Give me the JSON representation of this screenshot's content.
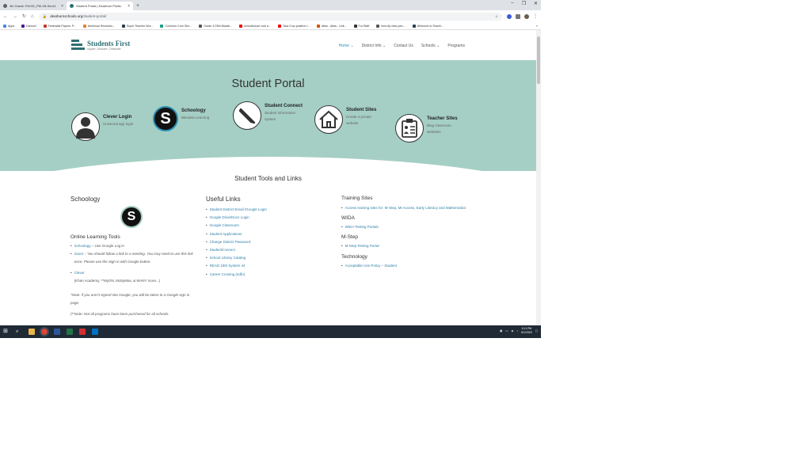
{
  "browser": {
    "tabs": [
      {
        "title": "4th Grade: PerXD_PM-1B-Sec11",
        "active": false
      },
      {
        "title": "Student Portal | Dearborn Public",
        "active": true
      }
    ],
    "new_tab": "+",
    "url_host": "dearbornschools.org",
    "url_path": "/student-portal/",
    "bookmarks": [
      "Apps",
      "Kahoot!",
      "Federalist Papers: P...",
      "American Revolutio...",
      "Super Teacher Wor...",
      "Common Core She...",
      "Grade 4 DRA Blackli...",
      "schoolhouse rock b...",
      "Tara Cruz-positive t...",
      "Atlas - Atlas - Unit...",
      "For Staff",
      "bms-flp-view-pen...",
      "Welcome to Teachi..."
    ]
  },
  "site": {
    "logo_name": "Students First",
    "logo_tagline": "Inspire. Educate. Celebrate.",
    "nav": [
      {
        "label": "Home",
        "caret": "⌄",
        "active": true
      },
      {
        "label": "District Info",
        "caret": "⌄",
        "active": false
      },
      {
        "label": "Contact Us",
        "caret": "",
        "active": false
      },
      {
        "label": "Schools",
        "caret": "⌄",
        "active": false
      },
      {
        "label": "Programs",
        "caret": "",
        "active": false
      }
    ],
    "hero_title": "Student Portal",
    "cards": {
      "clever": {
        "title": "Clever Login",
        "desc": "Universal app login"
      },
      "schoology": {
        "title": "Schoology",
        "desc": "Blended Learning",
        "glyph": "S"
      },
      "connect": {
        "title": "Student Connect",
        "desc": "Student information system"
      },
      "sites": {
        "title": "Student Sites",
        "desc": "Create a private website"
      },
      "teacher": {
        "title": "Teacher Sites",
        "desc": "Blog classroom websites"
      }
    },
    "tools_title": "Student Tools and Links",
    "schoology_col": {
      "heading": "Schoology",
      "glyph": "S",
      "subheading": "Online Learning Tools",
      "items": [
        {
          "link": "Schoology",
          "rest": " – Use Google Log in"
        },
        {
          "link": "Zoom",
          "rest": " – You should follow a link to a meeting. You may need to use this link once. Please use the Sign in with Google button."
        },
        {
          "link": "Clever",
          "rest": "(Khan Academy, **MyON, MobyMax, & MANY more...)"
        }
      ],
      "note1": "*Note: if you aren't signed into Google, you will be taken to a Google sign in page.",
      "note2": "(**Note: Not all programs have been purchased for all schools."
    },
    "useful_col": {
      "heading": "Useful Links",
      "links": [
        "Student District Email /Google Login",
        "Google Drive/Docs Login",
        "Google Classroom",
        "Student Applications",
        "Change District Password",
        "StudentConnect",
        "School Library Catalog",
        "READ 180/ System 44",
        "Career Cruising (edfo)"
      ]
    },
    "training_col": {
      "heading": "Training Sites",
      "training_item": "Access training sites for: M-Step, MI Access, Early Literacy and Mathematics",
      "wida_heading": "WIDA",
      "wida_item": "WIDA Testing Portals",
      "mstep_heading": "M-Step",
      "mstep_item": "M-Step Testing Portal",
      "tech_heading": "Technology",
      "tech_item": "Acceptable Use Policy – Student"
    }
  },
  "taskbar": {
    "time": "3:11 PM",
    "date": "6/1/2020"
  },
  "colors": {
    "hero": "#a5cfc4",
    "link": "#2f7fa8",
    "brand": "#2f6f73",
    "nav_active": "#2f8fb3"
  }
}
